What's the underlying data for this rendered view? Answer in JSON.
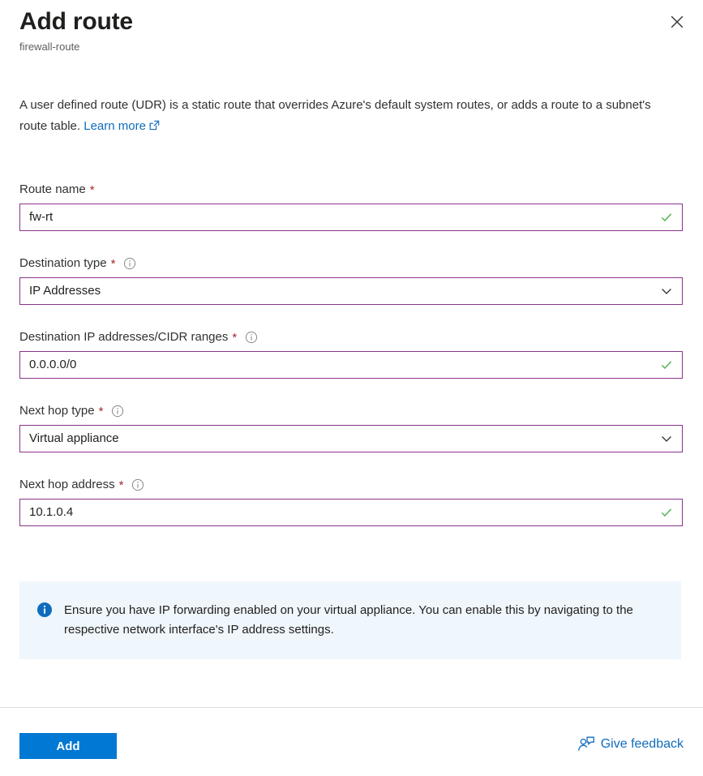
{
  "header": {
    "title": "Add route",
    "subtitle": "firewall-route",
    "close_label": "Close",
    "close_icon": "close-icon"
  },
  "description": {
    "text_before": "A user defined route (UDR) is a static route that overrides Azure's default system routes, or adds a route to a subnet's route table.",
    "link_label": "Learn more",
    "link_icon": "external-link-icon"
  },
  "form": {
    "required_marker": "*",
    "info_icon": "info-circle-icon",
    "validated_icon": "check-icon",
    "dropdown_icon": "chevron-down-icon",
    "fields": [
      {
        "id": "route-name",
        "label": "Route name",
        "required": true,
        "has_info": false,
        "type": "text",
        "value": "fw-rt",
        "placeholder": "",
        "valid": true
      },
      {
        "id": "destination-type",
        "label": "Destination type",
        "required": true,
        "has_info": true,
        "type": "select",
        "value": "IP Addresses",
        "placeholder": "",
        "valid": false
      },
      {
        "id": "destination-ip-ranges",
        "label": "Destination IP addresses/CIDR ranges",
        "required": true,
        "has_info": true,
        "type": "text",
        "value": "0.0.0.0/0",
        "placeholder": "",
        "valid": true
      },
      {
        "id": "next-hop-type",
        "label": "Next hop type",
        "required": true,
        "has_info": true,
        "type": "select",
        "value": "Virtual appliance",
        "placeholder": "",
        "valid": false
      },
      {
        "id": "next-hop-address",
        "label": "Next hop address",
        "required": true,
        "has_info": true,
        "type": "text",
        "value": "10.1.0.4",
        "placeholder": "",
        "valid": true
      }
    ]
  },
  "banner": {
    "icon": "info-filled-icon",
    "text": "Ensure you have IP forwarding enabled on your virtual appliance. You can enable this by navigating to the respective network interface's IP address settings."
  },
  "footer": {
    "add_label": "Add",
    "feedback_label": "Give feedback",
    "feedback_icon": "person-feedback-icon"
  },
  "colors": {
    "accent": "#0078d4",
    "link": "#0f6cbd",
    "field_border": "#8a348a",
    "required": "#a4262c",
    "valid": "#5ab55a",
    "banner_bg": "#eff6fc",
    "banner_icon": "#0f6cbd"
  }
}
